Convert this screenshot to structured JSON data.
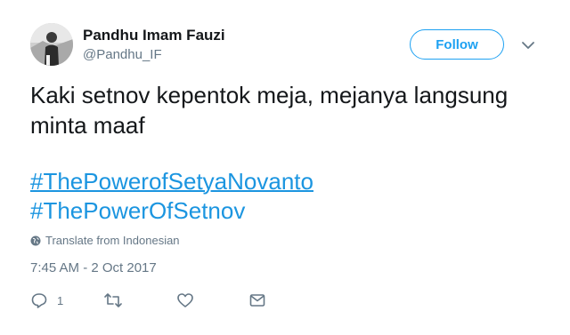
{
  "user": {
    "name": "Pandhu Imam Fauzi",
    "handle": "@Pandhu_IF"
  },
  "follow_label": "Follow",
  "tweet": {
    "text": "Kaki setnov kepentok meja, mejanya langsung minta maaf",
    "hashtags": [
      "#ThePowerofSetyaNovanto",
      "#ThePowerOfSetnov"
    ]
  },
  "translate_label": "Translate from Indonesian",
  "timestamp": "7:45 AM - 2 Oct 2017",
  "actions": {
    "reply_count": "1"
  },
  "icons": [
    "avatar-photo",
    "chevron-down-icon",
    "globe-icon",
    "reply-icon",
    "retweet-icon",
    "like-icon",
    "message-icon"
  ],
  "colors": {
    "accent": "#1da1f2",
    "hashtag": "#1b95e0",
    "muted": "#657786",
    "text": "#14171a"
  }
}
